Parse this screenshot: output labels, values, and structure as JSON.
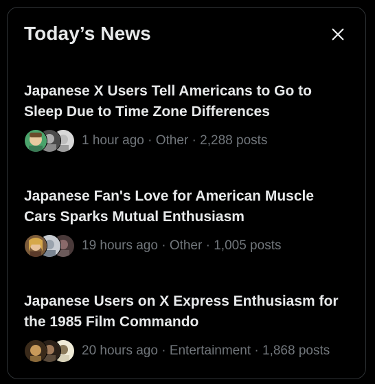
{
  "header": {
    "title": "Today’s News",
    "close_icon": "close-icon"
  },
  "news": [
    {
      "title": "Japanese X Users Tell Americans to Go to Sleep Due to Time Zone Differences",
      "time": "1 hour ago",
      "category": "Other",
      "posts": "2,288 posts",
      "avatar_colors": [
        "#4aa36b",
        "#7a7a7a",
        "#cfcfcf"
      ]
    },
    {
      "title": "Japanese Fan's Love for American Muscle Cars Sparks Mutual Enthusiasm",
      "time": "19 hours ago",
      "category": "Other",
      "posts": "1,005 posts",
      "avatar_colors": [
        "#c9a25a",
        "#9aa3ad",
        "#6b5a5a"
      ]
    },
    {
      "title": "Japanese Users on X Express Enthusiasm for the 1985 Film Commando",
      "time": "20 hours ago",
      "category": "Entertainment",
      "posts": "1,868 posts",
      "avatar_colors": [
        "#8a6a3a",
        "#5a4a3a",
        "#d8d2b8"
      ]
    }
  ],
  "separator": " · ",
  "colors": {
    "background": "#000000",
    "border": "#2f3336",
    "primary_text": "#e7e9ea",
    "secondary_text": "#71767b"
  }
}
